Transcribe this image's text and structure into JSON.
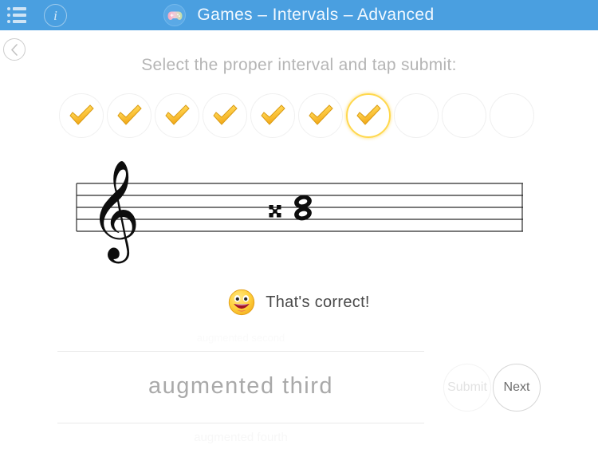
{
  "header": {
    "menu_icon": "list-menu-icon",
    "info_icon": "info-icon",
    "gamepad_icon": "gamepad-icon",
    "title": "Games – Intervals – Advanced",
    "background_color": "#4a9fe0"
  },
  "back_button": {
    "icon": "chevron-left-icon",
    "label": ""
  },
  "instruction": {
    "text": "Select the proper interval and tap submit:"
  },
  "progress": {
    "total": 10,
    "completed": 7,
    "current_index": 7,
    "items": [
      {
        "state": "correct"
      },
      {
        "state": "correct"
      },
      {
        "state": "correct"
      },
      {
        "state": "correct"
      },
      {
        "state": "correct"
      },
      {
        "state": "correct"
      },
      {
        "state": "current-correct"
      },
      {
        "state": "empty"
      },
      {
        "state": "empty"
      },
      {
        "state": "empty"
      }
    ],
    "highlight_color": "#ffd84d",
    "check_color": "#f5b51c"
  },
  "staff": {
    "clef": "treble-clef",
    "accidental": "double-sharp",
    "notes": [
      {
        "name": "lower-whole-note",
        "head": "whole"
      },
      {
        "name": "upper-whole-note",
        "head": "whole"
      }
    ],
    "line_count": 5
  },
  "feedback": {
    "emoji": "smiling-face-open-mouth",
    "text": "That's correct!"
  },
  "answer_picker": {
    "previous_option": "augmented second",
    "selected_option": "augmented third",
    "next_option": "augmented fourth"
  },
  "actions": {
    "submit_label": "Submit",
    "submit_enabled": false,
    "next_label": "Next",
    "next_enabled": true
  }
}
